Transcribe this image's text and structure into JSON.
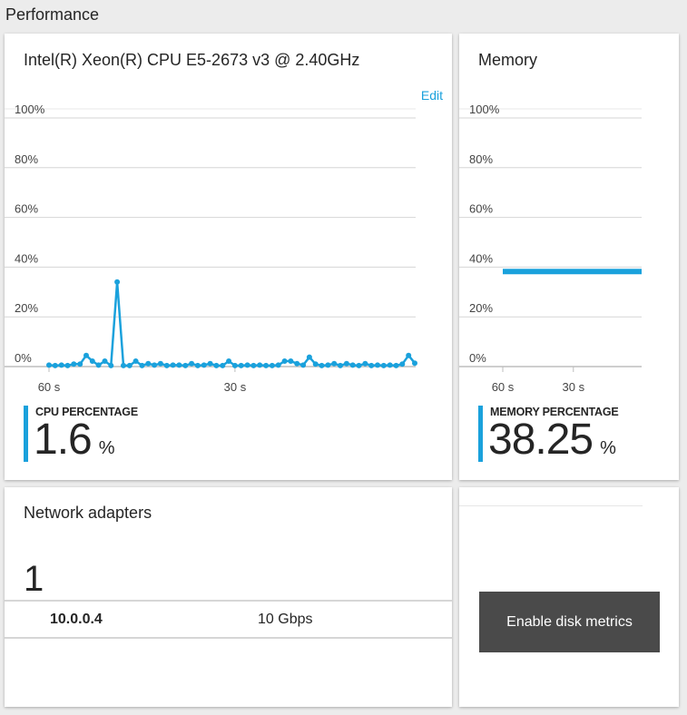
{
  "section_title": "Performance",
  "colors": {
    "accent": "#1aa1dc",
    "button_bg": "#4a4a4a",
    "grid": "#d6d6d6"
  },
  "cpu": {
    "title": "Intel(R) Xeon(R) CPU E5-2673 v3 @ 2.40GHz",
    "edit_label": "Edit",
    "metric_label": "CPU PERCENTAGE",
    "metric_value": "1.6",
    "metric_unit": "%"
  },
  "memory": {
    "title": "Memory",
    "metric_label": "MEMORY PERCENTAGE",
    "metric_value": "38.25",
    "metric_unit": "%"
  },
  "network": {
    "title": "Network adapters",
    "count": "1",
    "adapters": [
      {
        "ip": "10.0.0.4",
        "speed": "10 Gbps"
      }
    ]
  },
  "disk": {
    "button_label": "Enable disk metrics"
  },
  "chart_data": [
    {
      "type": "line",
      "name": "cpu",
      "ylim": [
        0,
        100
      ],
      "y_ticks": [
        "100%",
        "80%",
        "60%",
        "40%",
        "20%",
        "0%"
      ],
      "x_tick_labels": [
        "60 s",
        "30 s"
      ],
      "x": [
        60,
        59,
        58,
        57,
        56,
        55,
        54,
        53,
        52,
        51,
        50,
        49,
        48,
        47,
        46,
        45,
        44,
        43,
        42,
        41,
        40,
        39,
        38,
        37,
        36,
        35,
        34,
        33,
        32,
        31,
        30,
        29,
        28,
        27,
        26,
        25,
        24,
        23,
        22,
        21,
        20,
        19,
        18,
        17,
        16,
        15,
        14,
        13,
        12,
        11,
        10,
        9,
        8,
        7,
        6,
        5,
        4,
        3,
        2,
        1
      ],
      "values": [
        0.6,
        0.4,
        0.6,
        0.4,
        1.0,
        1.0,
        4.5,
        2.2,
        0.6,
        2.2,
        0.4,
        34,
        0.4,
        0.4,
        2.2,
        0.4,
        1.2,
        0.6,
        1.2,
        0.4,
        0.6,
        0.6,
        0.4,
        1.2,
        0.4,
        0.6,
        1.2,
        0.4,
        0.4,
        2.2,
        0.4,
        0.4,
        0.6,
        0.4,
        0.6,
        0.4,
        0.4,
        0.6,
        2.2,
        2.2,
        1.2,
        0.6,
        3.8,
        1.0,
        0.4,
        0.6,
        1.2,
        0.4,
        1.2,
        0.6,
        0.4,
        1.2,
        0.4,
        0.6,
        0.4,
        0.6,
        0.4,
        1.0,
        4.5,
        1.4
      ]
    },
    {
      "type": "line",
      "name": "memory",
      "ylim": [
        0,
        100
      ],
      "y_ticks": [
        "100%",
        "80%",
        "60%",
        "40%",
        "20%",
        "0%"
      ],
      "x_tick_labels": [
        "60 s",
        "30 s"
      ],
      "x": [
        60,
        1
      ],
      "values": [
        38.25,
        38.25
      ]
    }
  ]
}
